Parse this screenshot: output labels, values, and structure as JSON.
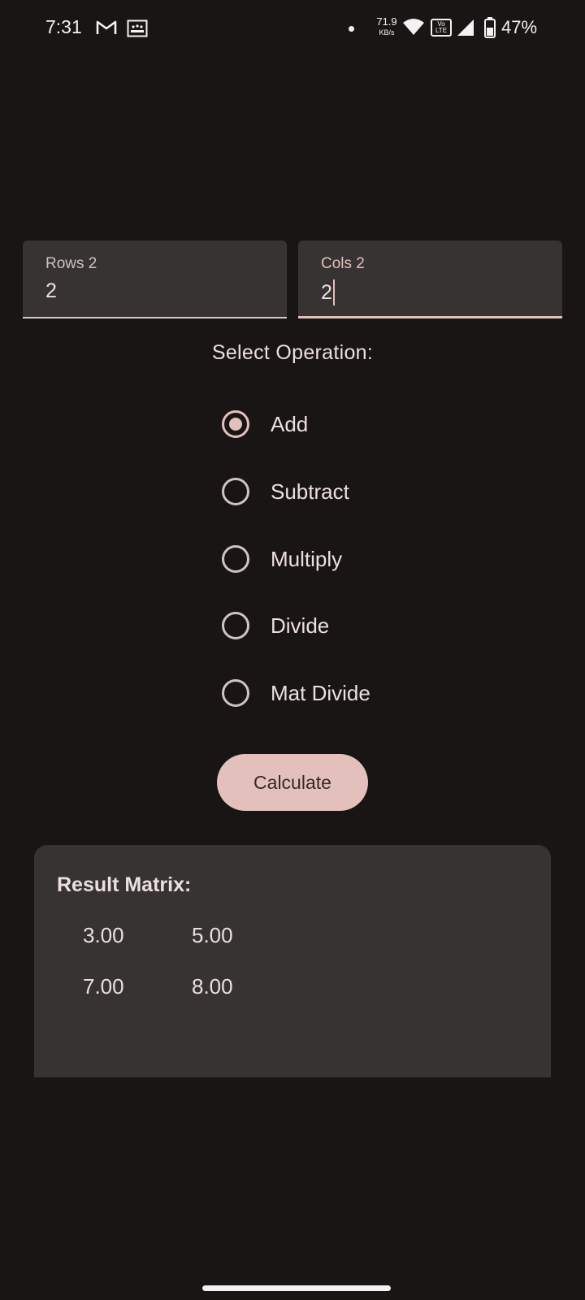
{
  "status_bar": {
    "time": "7:31",
    "net_speed_value": "71.9",
    "net_speed_unit": "KB/s",
    "volte": "Vo\nLTE",
    "battery": "47%",
    "icons": [
      "gmail-icon",
      "gallery-icon",
      "notification-dot-icon",
      "wifi-icon",
      "volte-icon",
      "signal-icon",
      "battery-icon"
    ]
  },
  "inputs": {
    "rows": {
      "label": "Rows 2",
      "value": "2"
    },
    "cols": {
      "label": "Cols 2",
      "value": "2"
    }
  },
  "operation": {
    "title": "Select Operation:",
    "options": [
      "Add",
      "Subtract",
      "Multiply",
      "Divide",
      "Mat Divide"
    ],
    "selected": "Add"
  },
  "calculate_label": "Calculate",
  "result": {
    "title": "Result Matrix:",
    "matrix": [
      [
        "3.00",
        "5.00"
      ],
      [
        "7.00",
        "8.00"
      ]
    ]
  },
  "colors": {
    "background": "#191514",
    "surface": "#373333",
    "accent": "#e3c0bb",
    "text": "#ece0de"
  }
}
